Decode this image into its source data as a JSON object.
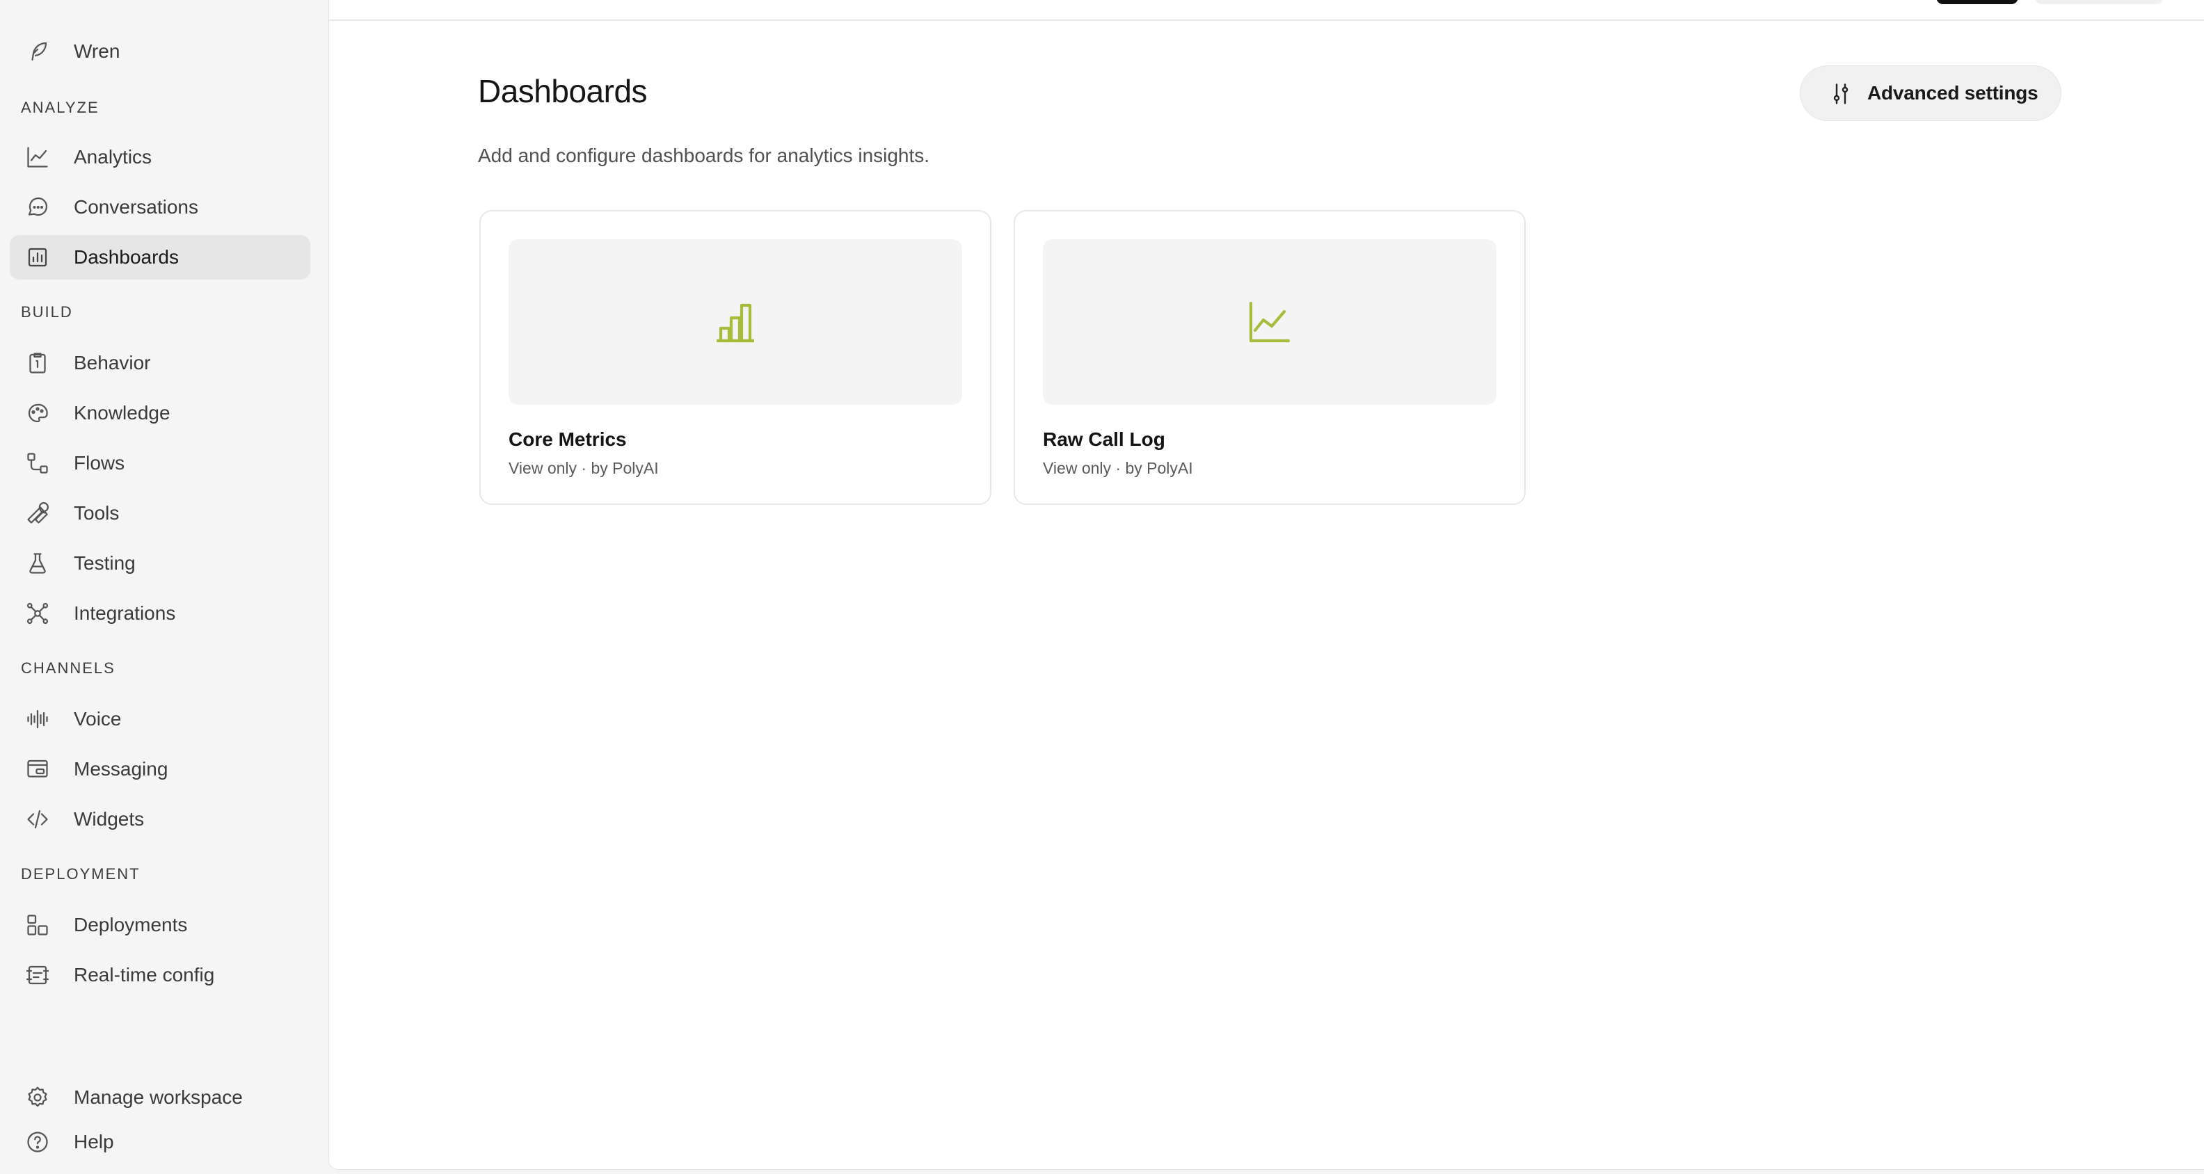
{
  "sidebar": {
    "brand": "Wren",
    "sections": {
      "analyze": "ANALYZE",
      "build": "BUILD",
      "channels": "CHANNELS",
      "deployment": "DEPLOYMENT"
    },
    "items": {
      "analytics": "Analytics",
      "conversations": "Conversations",
      "dashboards": "Dashboards",
      "behavior": "Behavior",
      "knowledge": "Knowledge",
      "flows": "Flows",
      "tools": "Tools",
      "testing": "Testing",
      "integrations": "Integrations",
      "voice": "Voice",
      "messaging": "Messaging",
      "widgets": "Widgets",
      "deployments": "Deployments",
      "realtime": "Real-time config",
      "manage": "Manage workspace",
      "help": "Help"
    },
    "active_item": "dashboards"
  },
  "main": {
    "title": "Dashboards",
    "subtitle": "Add and configure dashboards for analytics insights.",
    "advanced_settings_label": "Advanced settings",
    "cards": [
      {
        "name": "Core Metrics",
        "meta": "View only · by PolyAI",
        "icon": "bar-chart-icon"
      },
      {
        "name": "Raw Call Log",
        "meta": "View only · by PolyAI",
        "icon": "line-chart-icon"
      }
    ]
  },
  "colors": {
    "accent": "#a6bc3a",
    "active_bg": "#e6e6e6"
  }
}
